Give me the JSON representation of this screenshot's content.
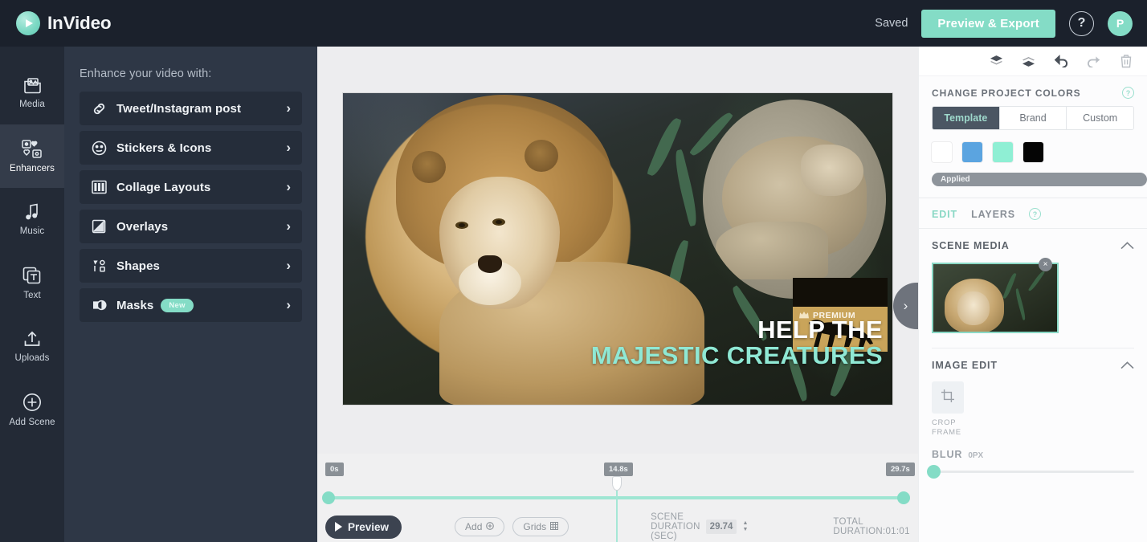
{
  "header": {
    "brand": "InVideo",
    "logo_icon": "play-circle-icon",
    "saved_label": "Saved",
    "preview_export_label": "Preview & Export",
    "help_label": "?",
    "avatar_initial": "P"
  },
  "rail": {
    "items": [
      {
        "label": "Media",
        "icon": "media-folder-icon",
        "active": false
      },
      {
        "label": "Enhancers",
        "icon": "enhancers-grid-icon",
        "active": true
      },
      {
        "label": "Music",
        "icon": "music-note-icon",
        "active": false
      },
      {
        "label": "Text",
        "icon": "text-layers-icon",
        "active": false
      },
      {
        "label": "Uploads",
        "icon": "upload-arrow-icon",
        "active": false
      },
      {
        "label": "Add Scene",
        "icon": "plus-circle-icon",
        "active": false
      }
    ]
  },
  "enhancers": {
    "title": "Enhance your video with:",
    "items": [
      {
        "label": "Tweet/Instagram post",
        "icon": "link-chain-icon",
        "badge": ""
      },
      {
        "label": "Stickers & Icons",
        "icon": "smiley-icon",
        "badge": ""
      },
      {
        "label": "Collage Layouts",
        "icon": "columns-icon",
        "badge": ""
      },
      {
        "label": "Overlays",
        "icon": "overlay-square-icon",
        "badge": ""
      },
      {
        "label": "Shapes",
        "icon": "shapes-icon",
        "badge": ""
      },
      {
        "label": "Masks",
        "icon": "mask-circle-icon",
        "badge": "New"
      }
    ],
    "chevron_icon": "chevron-right-icon"
  },
  "canvas": {
    "caption_line1": "HELP THE",
    "caption_line2": "MAJESTIC CREATURES",
    "premium_badge": "PREMIUM",
    "premium_icon": "crown-icon",
    "panel_toggle_icon": "chevron-right-icon",
    "caption_line1_color": "#ffffff",
    "caption_line2_color": "#8fe8d4"
  },
  "timeline": {
    "start_marker": "0s",
    "playhead_marker": "14.8s",
    "end_marker": "29.7s",
    "preview_label": "Preview",
    "preview_icon": "play-icon",
    "add_label": "Add",
    "add_icon": "add-circle-icon",
    "grids_label": "Grids",
    "grids_icon": "grid-icon",
    "scene_duration_label": "SCENE DURATION (SEC)",
    "scene_duration_value": "29.74",
    "total_duration_label": "TOTAL DURATION:01:01"
  },
  "right_panel": {
    "toolbar_icons": [
      {
        "name": "send-backward-icon",
        "dim": false
      },
      {
        "name": "bring-forward-icon",
        "dim": false
      },
      {
        "name": "undo-icon",
        "dim": false
      },
      {
        "name": "redo-icon",
        "dim": true
      },
      {
        "name": "delete-trash-icon",
        "dim": true
      }
    ],
    "colors_section": {
      "title": "CHANGE PROJECT COLORS",
      "help_icon": "help-circle-icon",
      "help_label": "?",
      "tabs": [
        {
          "label": "Template",
          "active": true
        },
        {
          "label": "Brand",
          "active": false
        },
        {
          "label": "Custom",
          "active": false
        }
      ],
      "swatches": [
        "#ffffff",
        "#5ba4e0",
        "#8fefd4",
        "#050505"
      ],
      "applied_label": "Applied"
    },
    "tabs": [
      {
        "label": "EDIT",
        "active": true
      },
      {
        "label": "LAYERS",
        "active": false
      }
    ],
    "tabs_help_icon": "help-circle-icon",
    "tabs_help_label": "?",
    "scene_media": {
      "title": "SCENE MEDIA",
      "collapse_icon": "chevron-up-icon",
      "remove_icon": "close-icon",
      "remove_label": "×"
    },
    "image_edit": {
      "title": "IMAGE EDIT",
      "collapse_icon": "chevron-up-icon",
      "crop_icon": "crop-icon",
      "crop_label": "CROP FRAME",
      "blur_label": "BLUR",
      "blur_value": "0PX"
    }
  }
}
